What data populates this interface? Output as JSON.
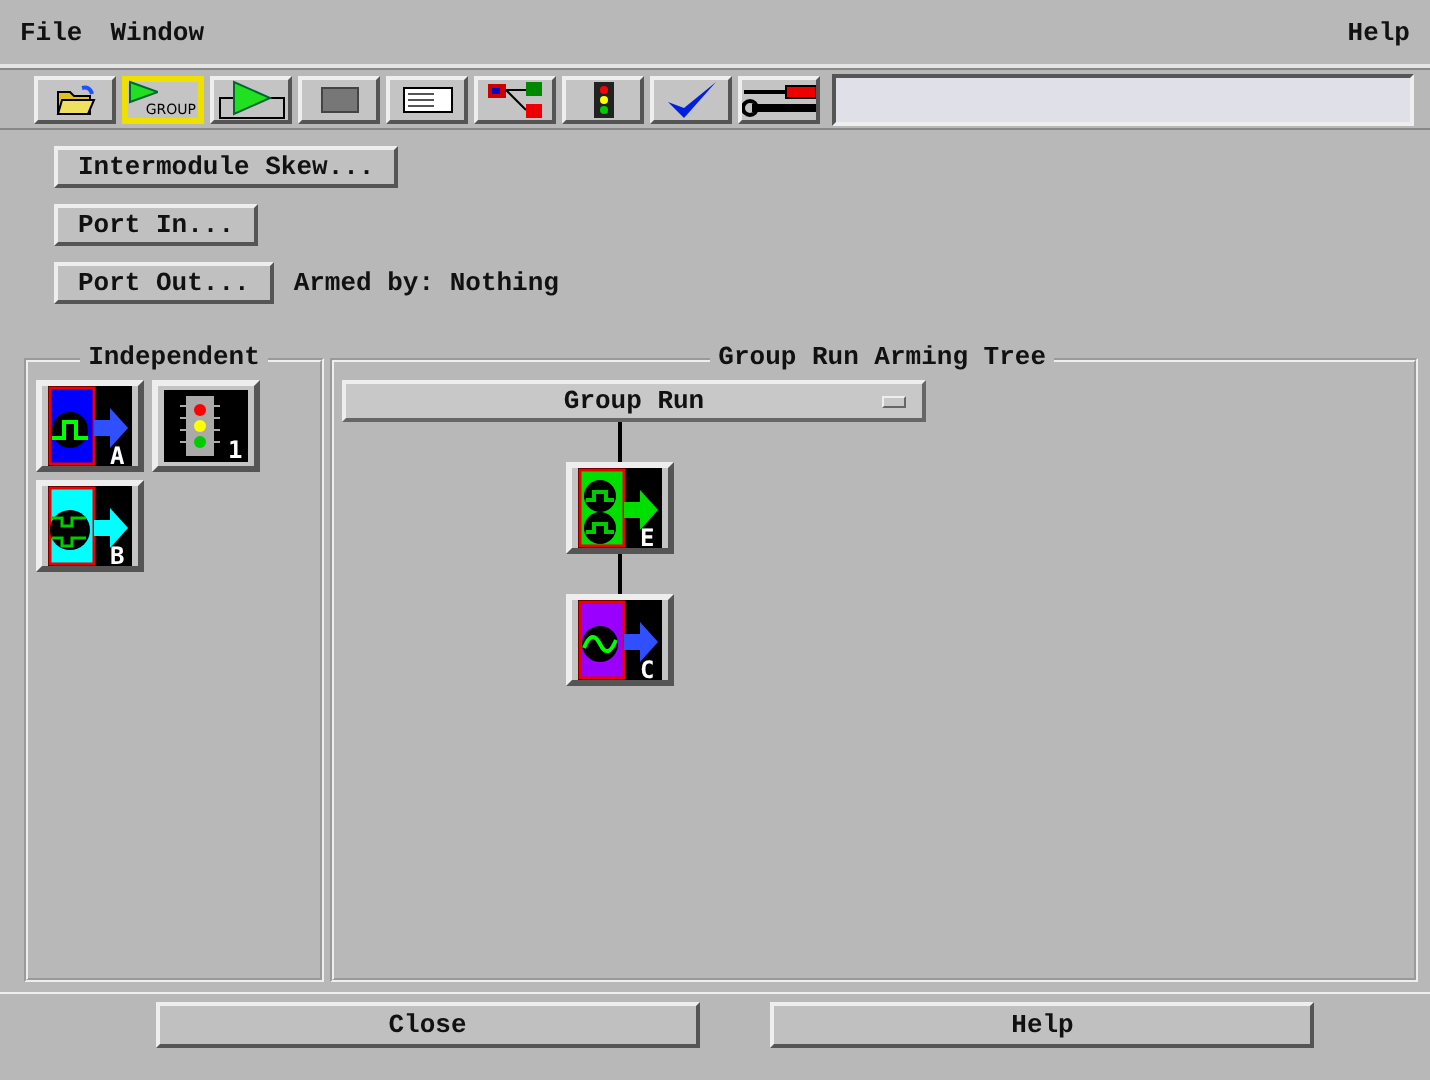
{
  "menu": [
    "File",
    "Window",
    "Help"
  ],
  "toolbar": [
    {
      "kind": "open",
      "selected": false
    },
    {
      "kind": "group-run",
      "label": "GROUP",
      "selected": true
    },
    {
      "kind": "run",
      "selected": false
    },
    {
      "kind": "stop",
      "selected": false
    },
    {
      "kind": "panel",
      "selected": false
    },
    {
      "kind": "tree",
      "selected": false
    },
    {
      "kind": "chip",
      "selected": false
    },
    {
      "kind": "check",
      "selected": false
    },
    {
      "kind": "tools",
      "selected": false
    }
  ],
  "buttons": [
    {
      "label": "Intermodule Skew..."
    },
    {
      "label": "Port In..."
    },
    {
      "label": "Port Out...",
      "note": "Armed by: Nothing"
    }
  ],
  "independent": {
    "title": "Independent",
    "modules": [
      {
        "kind": "pulse",
        "color": "#0000ff",
        "letter": "A"
      },
      {
        "kind": "chip",
        "letter": "1"
      },
      {
        "kind": "timing",
        "color": "#00ffff",
        "letter": "B"
      }
    ]
  },
  "arming_tree": {
    "title": "Group Run Arming Tree",
    "root": {
      "label": "Group Run",
      "children": [
        {
          "kind": "timing2",
          "color": "#00e000",
          "letter": "E",
          "children": [
            {
              "kind": "sine",
              "color": "#9900ff",
              "letter": "C"
            }
          ]
        }
      ]
    }
  },
  "footer": [
    "Close",
    "Help"
  ]
}
